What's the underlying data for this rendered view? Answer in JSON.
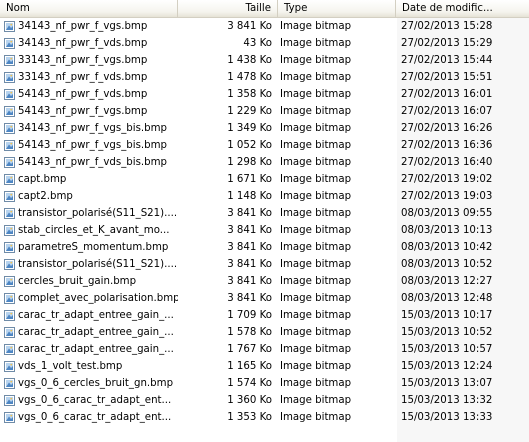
{
  "columns": {
    "name": "Nom",
    "size": "Taille",
    "type": "Type",
    "date": "Date de modific..."
  },
  "files": [
    {
      "name": "34143_nf_pwr_f_vgs.bmp",
      "size": "3 841 Ko",
      "type": "Image bitmap",
      "date": "27/02/2013 15:28"
    },
    {
      "name": "34143_nf_pwr_f_vds.bmp",
      "size": "43 Ko",
      "type": "Image bitmap",
      "date": "27/02/2013 15:29"
    },
    {
      "name": "33143_nf_pwr_f_vgs.bmp",
      "size": "1 438 Ko",
      "type": "Image bitmap",
      "date": "27/02/2013 15:44"
    },
    {
      "name": "33143_nf_pwr_f_vds.bmp",
      "size": "1 478 Ko",
      "type": "Image bitmap",
      "date": "27/02/2013 15:51"
    },
    {
      "name": "54143_nf_pwr_f_vds.bmp",
      "size": "1 358 Ko",
      "type": "Image bitmap",
      "date": "27/02/2013 16:01"
    },
    {
      "name": "54143_nf_pwr_f_vgs.bmp",
      "size": "1 229 Ko",
      "type": "Image bitmap",
      "date": "27/02/2013 16:07"
    },
    {
      "name": "34143_nf_pwr_f_vgs_bis.bmp",
      "size": "1 349 Ko",
      "type": "Image bitmap",
      "date": "27/02/2013 16:26"
    },
    {
      "name": "54143_nf_pwr_f_vgs_bis.bmp",
      "size": "1 052 Ko",
      "type": "Image bitmap",
      "date": "27/02/2013 16:36"
    },
    {
      "name": "54143_nf_pwr_f_vds_bis.bmp",
      "size": "1 298 Ko",
      "type": "Image bitmap",
      "date": "27/02/2013 16:40"
    },
    {
      "name": "capt.bmp",
      "size": "1 671 Ko",
      "type": "Image bitmap",
      "date": "27/02/2013 19:02"
    },
    {
      "name": "capt2.bmp",
      "size": "1 148 Ko",
      "type": "Image bitmap",
      "date": "27/02/2013 19:03"
    },
    {
      "name": "transistor_polarisé(S11_S21)....",
      "size": "3 841 Ko",
      "type": "Image bitmap",
      "date": "08/03/2013 09:55"
    },
    {
      "name": "stab_circles_et_K_avant_mo...",
      "size": "3 841 Ko",
      "type": "Image bitmap",
      "date": "08/03/2013 10:13"
    },
    {
      "name": "parametreS_momentum.bmp",
      "size": "3 841 Ko",
      "type": "Image bitmap",
      "date": "08/03/2013 10:42"
    },
    {
      "name": "transistor_polarisé(S11_S21)....",
      "size": "3 841 Ko",
      "type": "Image bitmap",
      "date": "08/03/2013 10:52"
    },
    {
      "name": "cercles_bruit_gain.bmp",
      "size": "3 841 Ko",
      "type": "Image bitmap",
      "date": "08/03/2013 12:27"
    },
    {
      "name": "complet_avec_polarisation.bmp",
      "size": "3 841 Ko",
      "type": "Image bitmap",
      "date": "08/03/2013 12:48"
    },
    {
      "name": "carac_tr_adapt_entree_gain_...",
      "size": "1 709 Ko",
      "type": "Image bitmap",
      "date": "15/03/2013 10:17"
    },
    {
      "name": "carac_tr_adapt_entree_gain_...",
      "size": "1 578 Ko",
      "type": "Image bitmap",
      "date": "15/03/2013 10:52"
    },
    {
      "name": "carac_tr_adapt_entree_gain_...",
      "size": "1 767 Ko",
      "type": "Image bitmap",
      "date": "15/03/2013 10:57"
    },
    {
      "name": "vds_1_volt_test.bmp",
      "size": "1 165 Ko",
      "type": "Image bitmap",
      "date": "15/03/2013 12:24"
    },
    {
      "name": "vgs_0_6_cercles_bruit_gn.bmp",
      "size": "1 574 Ko",
      "type": "Image bitmap",
      "date": "15/03/2013 13:07"
    },
    {
      "name": "vgs_0_6_carac_tr_adapt_ent...",
      "size": "1 360 Ko",
      "type": "Image bitmap",
      "date": "15/03/2013 13:32"
    },
    {
      "name": "vgs_0_6_carac_tr_adapt_ent...",
      "size": "1 353 Ko",
      "type": "Image bitmap",
      "date": "15/03/2013 13:33"
    }
  ],
  "file_icon": "bitmap-file-icon",
  "colors": {
    "sorted_column_bg": "#f7f7f7",
    "header_bg": "#ece9d8"
  }
}
